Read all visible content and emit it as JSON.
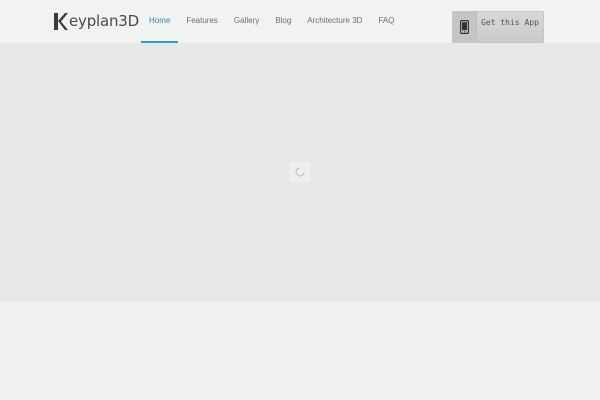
{
  "logo": {
    "text": "eyplan3D",
    "icon": "k-letter-logo"
  },
  "nav": {
    "items": [
      {
        "label": "Home",
        "active": true
      },
      {
        "label": "Features",
        "active": false
      },
      {
        "label": "Gallery",
        "active": false
      },
      {
        "label": "Blog",
        "active": false
      },
      {
        "label": "Architecture 3D",
        "active": false
      },
      {
        "label": "FAQ",
        "active": false
      }
    ]
  },
  "cta": {
    "label": "Get this App",
    "icon": "smartphone-icon"
  },
  "hero": {
    "loader_icon": "loading-spinner-icon"
  },
  "colors": {
    "accent": "#2aa0cf",
    "hero_bg": "#e8e8e8",
    "page_bg": "#eff2f1"
  }
}
